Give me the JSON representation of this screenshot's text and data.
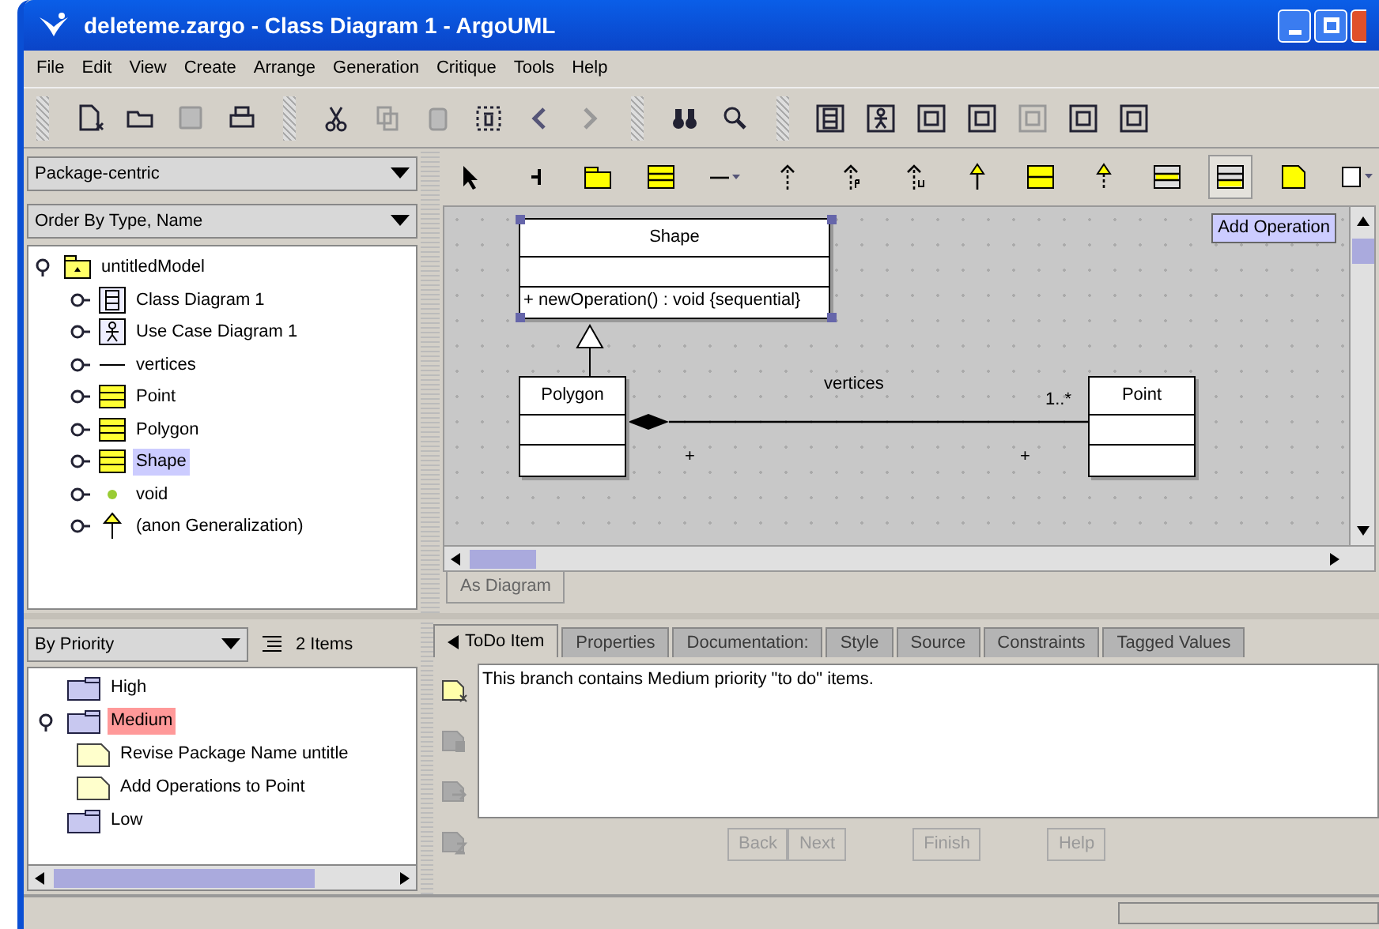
{
  "window": {
    "title": "deleteme.zargo - Class Diagram 1 - ArgoUML"
  },
  "menu": [
    "File",
    "Edit",
    "View",
    "Create",
    "Arrange",
    "Generation",
    "Critique",
    "Tools",
    "Help"
  ],
  "main_toolbar": [
    {
      "kind": "new",
      "disabled": false
    },
    {
      "kind": "open",
      "disabled": false
    },
    {
      "kind": "save",
      "disabled": true
    },
    {
      "kind": "print",
      "disabled": false
    },
    {
      "kind": "sep"
    },
    {
      "kind": "cut",
      "disabled": false
    },
    {
      "kind": "copy",
      "disabled": true
    },
    {
      "kind": "paste",
      "disabled": true
    },
    {
      "kind": "delete",
      "disabled": false
    },
    {
      "kind": "back",
      "disabled": false
    },
    {
      "kind": "forward",
      "disabled": true
    },
    {
      "kind": "sep"
    },
    {
      "kind": "find",
      "disabled": false
    },
    {
      "kind": "zoom",
      "disabled": false
    },
    {
      "kind": "sep"
    },
    {
      "kind": "classdiagram",
      "disabled": false
    },
    {
      "kind": "usecase",
      "disabled": false
    },
    {
      "kind": "diagram",
      "disabled": false
    },
    {
      "kind": "diagram",
      "disabled": false
    },
    {
      "kind": "diagram",
      "disabled": true
    },
    {
      "kind": "diagram",
      "disabled": false
    },
    {
      "kind": "diagram",
      "disabled": false
    }
  ],
  "explorer": {
    "perspective": "Package-centric",
    "order": "Order By Type, Name",
    "tree": [
      {
        "label": "untitledModel",
        "kind": "package",
        "expanded": true,
        "selected": false,
        "children": [
          {
            "label": "Class Diagram 1",
            "kind": "classdiagram",
            "expanded": false,
            "selected": false
          },
          {
            "label": "Use Case Diagram 1",
            "kind": "usecase",
            "expanded": false,
            "selected": false
          },
          {
            "label": "vertices",
            "kind": "association",
            "expanded": false,
            "selected": false
          },
          {
            "label": "Point",
            "kind": "class",
            "expanded": false,
            "selected": false
          },
          {
            "label": "Polygon",
            "kind": "class",
            "expanded": false,
            "selected": false
          },
          {
            "label": "Shape",
            "kind": "class",
            "expanded": false,
            "selected": true
          },
          {
            "label": "void",
            "kind": "datatype",
            "expanded": false,
            "selected": false
          },
          {
            "label": "(anon Generalization)",
            "kind": "generalization",
            "expanded": false,
            "selected": false
          }
        ]
      }
    ]
  },
  "diagram_tools": [
    {
      "kind": "select",
      "selected": false
    },
    {
      "kind": "broom",
      "selected": false
    },
    {
      "kind": "package",
      "selected": false
    },
    {
      "kind": "class",
      "selected": false
    },
    {
      "kind": "association",
      "selected": false
    },
    {
      "kind": "dependency",
      "selected": false
    },
    {
      "kind": "permission",
      "selected": false
    },
    {
      "kind": "usage",
      "selected": false
    },
    {
      "kind": "generalization",
      "selected": false
    },
    {
      "kind": "interface",
      "selected": false
    },
    {
      "kind": "realization",
      "selected": false
    },
    {
      "kind": "attribute",
      "selected": false
    },
    {
      "kind": "operation",
      "selected": true
    },
    {
      "kind": "note",
      "selected": false
    },
    {
      "kind": "shape",
      "selected": false
    }
  ],
  "diagram": {
    "tooltip": "Add Operation",
    "classes": [
      {
        "name": "Shape",
        "selected": true,
        "operations": [
          "+ newOperation() : void {sequential}"
        ]
      },
      {
        "name": "Polygon",
        "selected": false
      },
      {
        "name": "Point",
        "selected": false
      }
    ],
    "association": {
      "name": "vertices",
      "multiplicity": "1..*",
      "ends": [
        "+",
        "+"
      ]
    },
    "tabs": [
      {
        "label": "As Diagram",
        "selected": true
      }
    ]
  },
  "todo": {
    "grouping": "By Priority",
    "count": "2 Items",
    "tree": [
      {
        "label": "High",
        "kind": "folder",
        "selected": false
      },
      {
        "label": "Medium",
        "kind": "folder",
        "expanded": true,
        "selected": true,
        "children": [
          {
            "label": "Revise Package Name untitle",
            "kind": "item",
            "selected": false
          },
          {
            "label": "Add Operations to Point",
            "kind": "item",
            "selected": false
          }
        ]
      },
      {
        "label": "Low",
        "kind": "folder",
        "selected": false
      }
    ]
  },
  "details": {
    "tabs": [
      {
        "label": "ToDo Item",
        "selected": true
      },
      {
        "label": "Properties",
        "selected": false
      },
      {
        "label": "Documentation:",
        "selected": false
      },
      {
        "label": "Style",
        "selected": false
      },
      {
        "label": "Source",
        "selected": false
      },
      {
        "label": "Constraints",
        "selected": false
      },
      {
        "label": "Tagged Values",
        "selected": false
      }
    ],
    "text": "This branch contains Medium priority \"to do\" items.",
    "side_tools": [
      {
        "kind": "newtodo",
        "disabled": false
      },
      {
        "kind": "resolve",
        "disabled": true
      },
      {
        "kind": "forward",
        "disabled": true
      },
      {
        "kind": "snooze",
        "disabled": true
      }
    ],
    "buttons": [
      {
        "label": "Back",
        "disabled": true
      },
      {
        "label": "Next",
        "disabled": true
      },
      {
        "label": "Finish",
        "disabled": true
      },
      {
        "label": "Help",
        "disabled": true
      }
    ]
  }
}
